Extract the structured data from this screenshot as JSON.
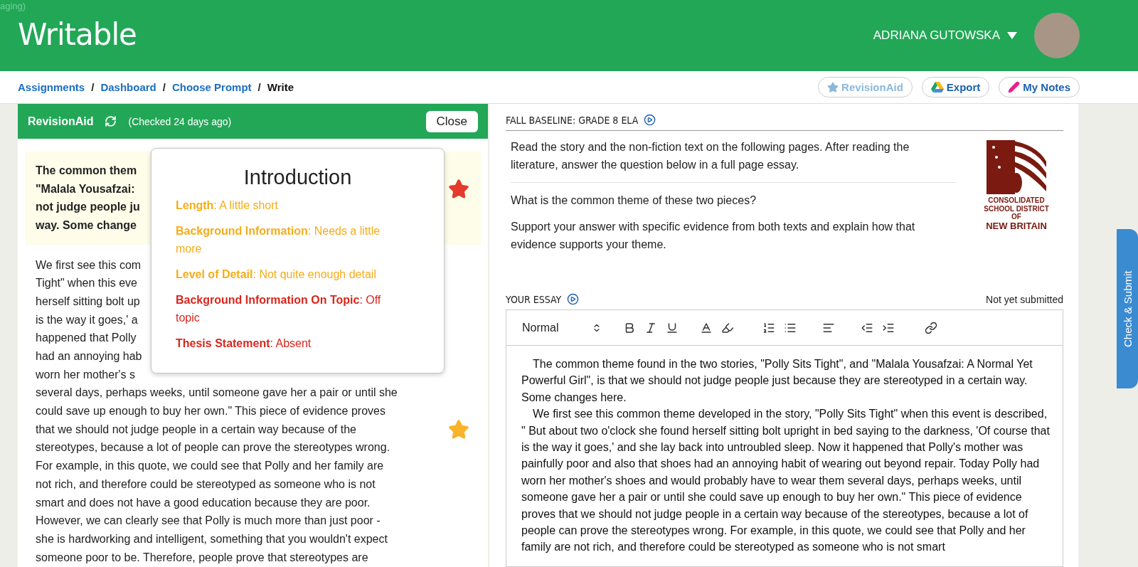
{
  "env_label": "aging)",
  "header": {
    "logo": "Writable",
    "user": "ADRIANA GUTOWSKA"
  },
  "breadcrumb_separator": "/",
  "breadcrumbs": [
    {
      "label": "Assignments",
      "current": false
    },
    {
      "label": "Dashboard",
      "current": false
    },
    {
      "label": "Choose Prompt",
      "current": false
    },
    {
      "label": "Write",
      "current": true
    }
  ],
  "actions": [
    {
      "label": "RevisionAid",
      "kind": "revision",
      "disabled": true
    },
    {
      "label": "Export",
      "kind": "export",
      "disabled": false
    },
    {
      "label": "My Notes",
      "kind": "notes",
      "disabled": false
    }
  ],
  "revision_panel": {
    "title": "RevisionAid",
    "status": "(Checked 24 days ago)",
    "close": "Close",
    "blocks": [
      {
        "highlighted": true,
        "lines": [
          {
            "text": "The common them"
          },
          {
            "text": "\"Malala Yousafzai:",
            "star": {
              "color": "#e53a2e"
            }
          },
          {
            "text": "not judge people ju"
          },
          {
            "text": "way. Some change"
          }
        ]
      },
      {
        "highlighted": false,
        "lines": [
          {
            "text": "We first see this com"
          },
          {
            "text": "Tight\" when this eve"
          },
          {
            "text": "herself sitting bolt up"
          },
          {
            "text": "is the way it goes,' a"
          },
          {
            "text": "happened that Polly"
          },
          {
            "text": "had an annoying hab"
          },
          {
            "text": "worn her mother's s"
          },
          {
            "text": "several days, perhaps weeks, until someone gave her a pair or until she"
          },
          {
            "text": "could save up enough to buy her own.\" This piece of evidence proves"
          },
          {
            "text": "that we should not judge people in a certain way because of the",
            "star": {
              "color": "#f9b42a"
            }
          },
          {
            "text": "stereotypes, because a lot of people can prove the stereotypes wrong."
          },
          {
            "text": "For example, in this quote, we could see that Polly and her family are"
          },
          {
            "text": "not rich, and therefore could be stereotyped as someone who is not"
          },
          {
            "text": "smart and does not have a good education because they are poor."
          },
          {
            "text": "However, we can clearly see that Polly is much more than just poor -"
          },
          {
            "text": "she is hardworking and intelligent, something that you wouldn't expect"
          },
          {
            "text": "someone poor to be. Therefore, people prove that stereotypes are"
          }
        ]
      }
    ]
  },
  "popup": {
    "title": "Introduction",
    "items": [
      {
        "text": "**Length**: A little short",
        "color": "#f6ac19"
      },
      {
        "text": "**Background Information**: Needs a little more",
        "color": "#f6ac19"
      },
      {
        "text": "**Level of Detail**: Not quite enough detail",
        "color": "#f6ac19"
      },
      {
        "text": "**Background Information On Topic**: Off topic",
        "color": "#d9261c"
      },
      {
        "text": "**Thesis Statement**: Absent",
        "color": "#d9261c"
      }
    ]
  },
  "prompt": {
    "title": "FALL BASELINE: GRADE 8 ELA",
    "intro": "Read the story and the non-fiction text on the following pages. After reading the literature, answer the question below in a full page essay.",
    "questions": [
      "What is the common theme of these two pieces?",
      "Support your answer with specific evidence from both texts and explain how that evidence supports your theme."
    ],
    "logo_lines": [
      "CONSOLIDATED",
      "SCHOOL DISTRICT",
      "OF",
      "NEW BRITAIN"
    ]
  },
  "essay": {
    "title": "YOUR ESSAY",
    "status": "Not yet submitted",
    "format": "Normal",
    "paragraphs": [
      "The common theme found in the two stories, \"Polly Sits Tight\", and \"Malala Yousafzai: A Normal Yet Powerful Girl\", is that we should not judge people just because they are stereotyped in a certain way. Some changes here.",
      "We first see this common theme developed in the story, \"Polly Sits Tight\" when this event is described, \"  But about two o'clock she found herself sitting bolt upright in bed saying to the darkness, 'Of course that is the way it goes,' and she lay back into untroubled sleep. Now it happened that Polly's mother was painfully poor and also that shoes had an annoying habit of wearing out beyond repair. Today Polly had worn her mother's shoes and would probably have to wear them several days, perhaps weeks, until someone gave her a pair or until she could save up enough to buy her own.\" This piece of evidence proves that we should not judge people in a certain way because of the stereotypes, because a lot of people can prove the stereotypes wrong. For example, in this quote, we could see that Polly and her family are not rich, and therefore could be stereotyped as someone who is not smart"
    ]
  },
  "submit": "Check & Submit"
}
